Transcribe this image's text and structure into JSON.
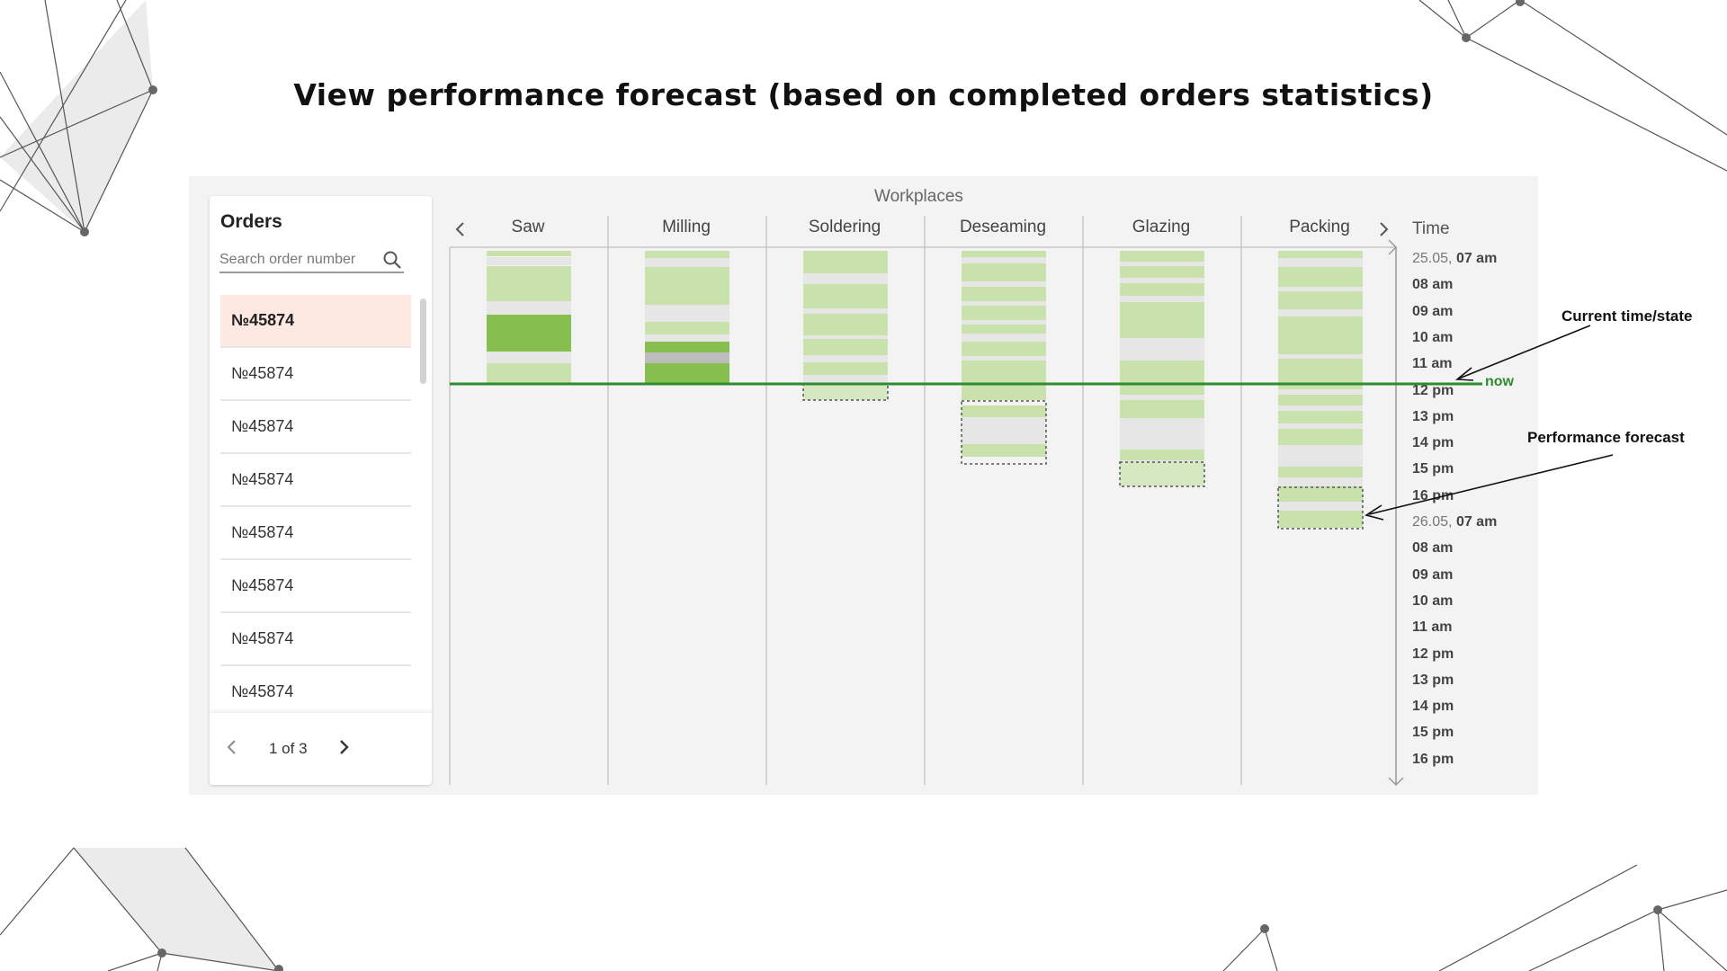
{
  "title": "View performance forecast (based on completed orders statistics)",
  "orders": {
    "title": "Orders",
    "search_placeholder": "Search order number",
    "items": [
      "№45874",
      "№45874",
      "№45874",
      "№45874",
      "№45874",
      "№45874",
      "№45874",
      "№45874"
    ],
    "selected_index": 0,
    "pager": {
      "label": "1 of 3"
    }
  },
  "workplaces": {
    "label": "Workplaces",
    "columns": [
      "Saw",
      "Milling",
      "Soldering",
      "Deseaming",
      "Glazing",
      "Packing"
    ]
  },
  "time": {
    "title": "Time",
    "labels": [
      {
        "date": "25.05,",
        "text": "07 am"
      },
      {
        "date": "",
        "text": "08 am"
      },
      {
        "date": "",
        "text": "09 am"
      },
      {
        "date": "",
        "text": "10 am"
      },
      {
        "date": "",
        "text": "11 am"
      },
      {
        "date": "",
        "text": "12 pm"
      },
      {
        "date": "",
        "text": "13 pm"
      },
      {
        "date": "",
        "text": "14 pm"
      },
      {
        "date": "",
        "text": "15 pm"
      },
      {
        "date": "",
        "text": "16 pm"
      },
      {
        "date": "26.05,",
        "text": "07 am"
      },
      {
        "date": "",
        "text": "08 am"
      },
      {
        "date": "",
        "text": "09 am"
      },
      {
        "date": "",
        "text": "10 am"
      },
      {
        "date": "",
        "text": "11 am"
      },
      {
        "date": "",
        "text": "12 pm"
      },
      {
        "date": "",
        "text": "13 pm"
      },
      {
        "date": "",
        "text": "14 pm"
      },
      {
        "date": "",
        "text": "15 pm"
      },
      {
        "date": "",
        "text": "16 pm"
      }
    ]
  },
  "now_label": "now",
  "annotations": {
    "current_time": "Current time/state",
    "forecast": "Performance forecast"
  },
  "colors": {
    "completed_light": "#c9e2ab",
    "completed_dark": "#86bf4e",
    "idle": "#e6e6e6",
    "now_line": "#2e8b2e",
    "selected_row": "#fde9e1"
  },
  "icons": [
    "search-icon",
    "chevron-left-icon",
    "chevron-right-icon"
  ]
}
